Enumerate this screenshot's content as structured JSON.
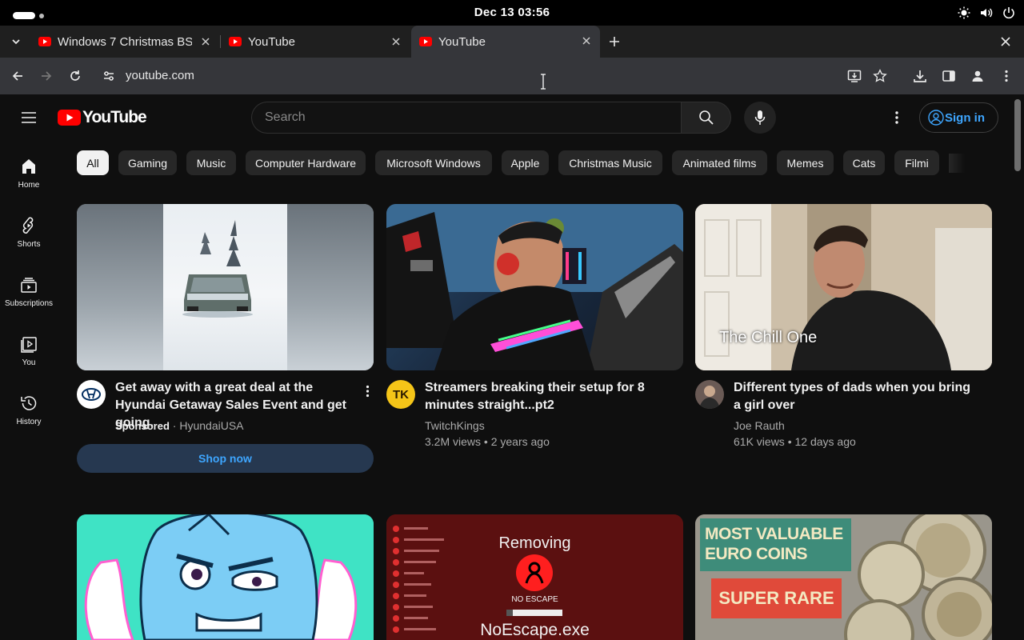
{
  "system": {
    "clock": "Dec 13  03:56"
  },
  "browser": {
    "tabs": [
      {
        "title": "Windows 7 Christmas BS"
      },
      {
        "title": "YouTube"
      },
      {
        "title": "YouTube"
      }
    ],
    "url": "youtube.com"
  },
  "youtube": {
    "logo_text": "YouTube",
    "search_placeholder": "Search",
    "sign_in": "Sign in",
    "nav": [
      {
        "label": "Home",
        "icon": "home-icon"
      },
      {
        "label": "Shorts",
        "icon": "shorts-icon"
      },
      {
        "label": "Subscriptions",
        "icon": "subscriptions-icon"
      },
      {
        "label": "You",
        "icon": "you-icon"
      },
      {
        "label": "History",
        "icon": "history-icon"
      }
    ],
    "chips": [
      "All",
      "Gaming",
      "Music",
      "Computer Hardware",
      "Microsoft Windows",
      "Apple",
      "Christmas Music",
      "Animated films",
      "Memes",
      "Cats",
      "Filmi"
    ],
    "videos": [
      {
        "title": "Get away with a great deal at the Hyundai Getaway Sales Event and get going.",
        "sponsored": "Sponsored",
        "channel": "HyundaiUSA",
        "cta": "Shop now"
      },
      {
        "title": "Streamers breaking their setup for 8 minutes straight...pt2",
        "channel": "TwitchKings",
        "stats": "3.2M views • 2 years ago",
        "avatar_text": "TK"
      },
      {
        "title": "Different types of dads when you bring a girl over",
        "channel": "Joe Rauth",
        "stats": "61K views • 12 days ago",
        "thumb_overlay": "The Chill One"
      }
    ],
    "row2": [
      {
        "thumb_title": "Removing",
        "thumb_sub": "NO ESCAPE",
        "thumb_bottom": "NoEscape.exe"
      },
      {
        "thumb_line1": "MOST VALUABLE",
        "thumb_line2": "EURO COINS",
        "thumb_badge": "SUPER RARE"
      }
    ]
  }
}
